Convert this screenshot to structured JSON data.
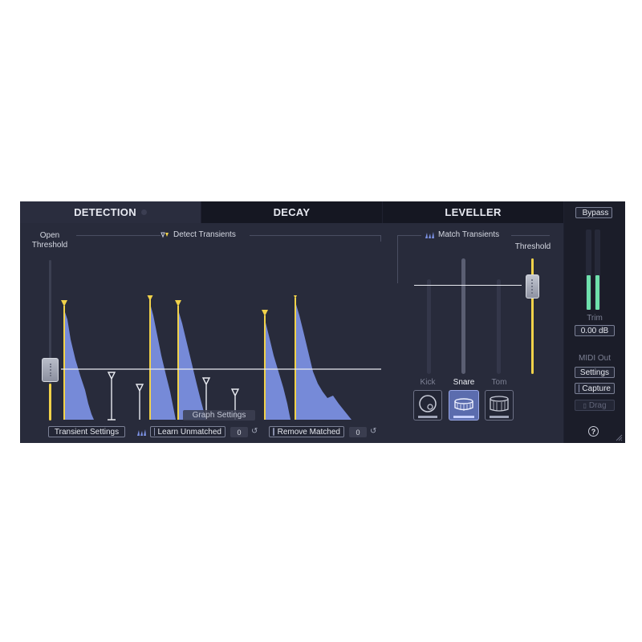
{
  "tabs": [
    {
      "label": "DETECTION"
    },
    {
      "label": "DECAY"
    },
    {
      "label": "LEVELLER"
    }
  ],
  "detection": {
    "open_threshold_label": "Open\nThreshold",
    "detect_transients_label": "Detect Transients",
    "transient_settings_label": "Transient Settings",
    "learn_unmatched_label": "Learn Unmatched",
    "learn_unmatched_count": "0",
    "remove_matched_label": "Remove Matched",
    "remove_matched_count": "0",
    "graph_settings_label": "Graph Settings",
    "open_threshold_level": 0.37
  },
  "match": {
    "match_transients_label": "Match Transients",
    "threshold_label": "Threshold",
    "threshold_level": 0.85,
    "instruments": [
      {
        "label": "Kick",
        "icon": "kick-drum-icon",
        "active": false
      },
      {
        "label": "Snare",
        "icon": "snare-drum-icon",
        "active": true
      },
      {
        "label": "Tom",
        "icon": "tom-drum-icon",
        "active": false
      }
    ]
  },
  "side": {
    "bypass_label": "Bypass",
    "trim_label": "Trim",
    "trim_value": "0.00 dB",
    "midi_out_label": "MIDI Out",
    "settings_label": "Settings",
    "capture_label": "Capture",
    "drag_label": "Drag",
    "help_label": "?"
  },
  "colors": {
    "accent_yellow": "#f1d24a",
    "waveform_blue": "#7d93e6",
    "meter_green": "#6fe0ac"
  }
}
